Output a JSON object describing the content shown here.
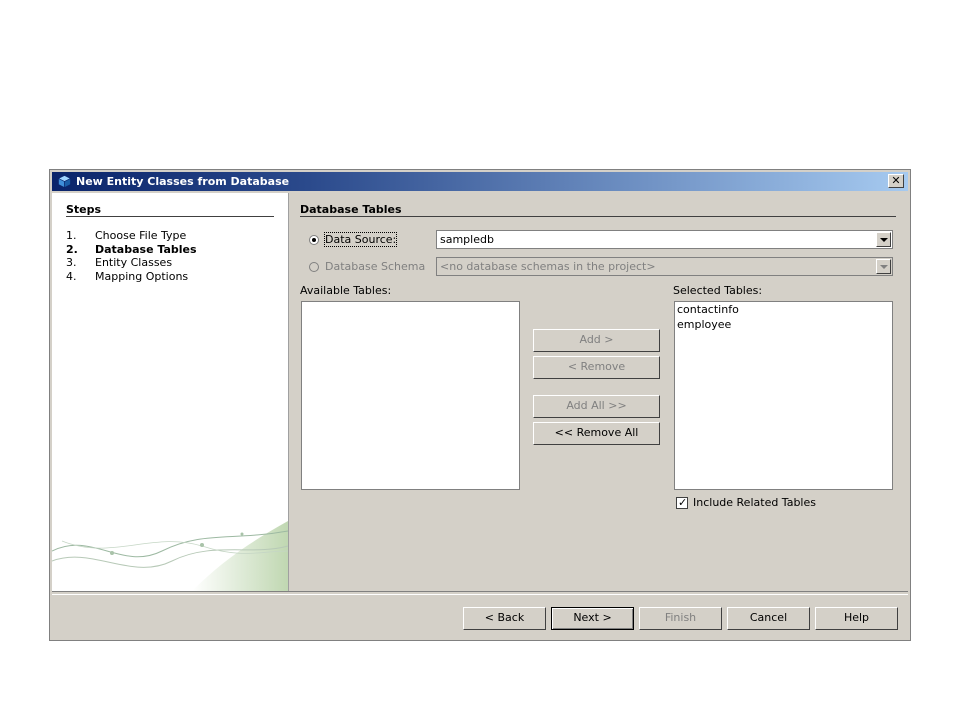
{
  "dialog": {
    "title": "New Entity Classes from Database",
    "close_label": "✕"
  },
  "steps": {
    "title": "Steps",
    "items": [
      {
        "num": "1.",
        "label": "Choose File Type",
        "active": false
      },
      {
        "num": "2.",
        "label": "Database Tables",
        "active": true
      },
      {
        "num": "3.",
        "label": "Entity Classes",
        "active": false
      },
      {
        "num": "4.",
        "label": "Mapping Options",
        "active": false
      }
    ]
  },
  "panel": {
    "title": "Database Tables",
    "data_source": {
      "label": "Data Source:",
      "selected": true,
      "value": "sampledb"
    },
    "database_schema": {
      "label": "Database Schema",
      "selected": false,
      "value": "<no database schemas in the project>"
    },
    "available_label": "Available Tables:",
    "available_tables": [],
    "selected_label": "Selected Tables:",
    "selected_tables": [
      "contactinfo",
      "employee"
    ],
    "buttons": {
      "add": "Add >",
      "remove": "< Remove",
      "add_all": "Add All >>",
      "remove_all": "<< Remove All"
    },
    "include_related": {
      "label": "Include Related Tables",
      "checked": true
    }
  },
  "footer": {
    "back": "< Back",
    "next": "Next >",
    "finish": "Finish",
    "cancel": "Cancel",
    "help": "Help"
  }
}
